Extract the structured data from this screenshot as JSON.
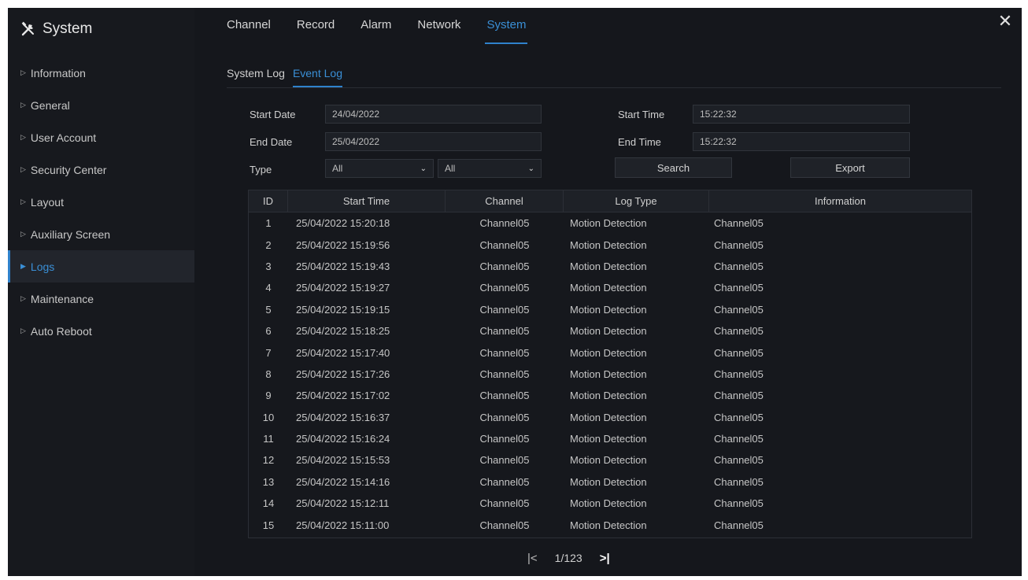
{
  "app": {
    "title": "System",
    "close_symbol": "✕"
  },
  "topnav": [
    {
      "label": "Channel",
      "active": false
    },
    {
      "label": "Record",
      "active": false
    },
    {
      "label": "Alarm",
      "active": false
    },
    {
      "label": "Network",
      "active": false
    },
    {
      "label": "System",
      "active": true
    }
  ],
  "sidebar": {
    "items": [
      {
        "label": "Information",
        "active": false
      },
      {
        "label": "General",
        "active": false
      },
      {
        "label": "User Account",
        "active": false
      },
      {
        "label": "Security Center",
        "active": false
      },
      {
        "label": "Layout",
        "active": false
      },
      {
        "label": "Auxiliary Screen",
        "active": false
      },
      {
        "label": "Logs",
        "active": true
      },
      {
        "label": "Maintenance",
        "active": false
      },
      {
        "label": "Auto Reboot",
        "active": false
      }
    ]
  },
  "subtabs": [
    {
      "label": "System Log",
      "active": false
    },
    {
      "label": "Event Log",
      "active": true
    }
  ],
  "filters": {
    "start_date_label": "Start Date",
    "start_date_value": "24/04/2022",
    "end_date_label": "End Date",
    "end_date_value": "25/04/2022",
    "type_label": "Type",
    "type_value_1": "All",
    "type_value_2": "All",
    "start_time_label": "Start Time",
    "start_time_value": "15:22:32",
    "end_time_label": "End Time",
    "end_time_value": "15:22:32",
    "search_label": "Search",
    "export_label": "Export"
  },
  "table": {
    "columns": [
      "ID",
      "Start Time",
      "Channel",
      "Log Type",
      "Information"
    ],
    "rows": [
      [
        "1",
        "25/04/2022 15:20:18",
        "Channel05",
        "Motion Detection",
        "Channel05"
      ],
      [
        "2",
        "25/04/2022 15:19:56",
        "Channel05",
        "Motion Detection",
        "Channel05"
      ],
      [
        "3",
        "25/04/2022 15:19:43",
        "Channel05",
        "Motion Detection",
        "Channel05"
      ],
      [
        "4",
        "25/04/2022 15:19:27",
        "Channel05",
        "Motion Detection",
        "Channel05"
      ],
      [
        "5",
        "25/04/2022 15:19:15",
        "Channel05",
        "Motion Detection",
        "Channel05"
      ],
      [
        "6",
        "25/04/2022 15:18:25",
        "Channel05",
        "Motion Detection",
        "Channel05"
      ],
      [
        "7",
        "25/04/2022 15:17:40",
        "Channel05",
        "Motion Detection",
        "Channel05"
      ],
      [
        "8",
        "25/04/2022 15:17:26",
        "Channel05",
        "Motion Detection",
        "Channel05"
      ],
      [
        "9",
        "25/04/2022 15:17:02",
        "Channel05",
        "Motion Detection",
        "Channel05"
      ],
      [
        "10",
        "25/04/2022 15:16:37",
        "Channel05",
        "Motion Detection",
        "Channel05"
      ],
      [
        "11",
        "25/04/2022 15:16:24",
        "Channel05",
        "Motion Detection",
        "Channel05"
      ],
      [
        "12",
        "25/04/2022 15:15:53",
        "Channel05",
        "Motion Detection",
        "Channel05"
      ],
      [
        "13",
        "25/04/2022 15:14:16",
        "Channel05",
        "Motion Detection",
        "Channel05"
      ],
      [
        "14",
        "25/04/2022 15:12:11",
        "Channel05",
        "Motion Detection",
        "Channel05"
      ],
      [
        "15",
        "25/04/2022 15:11:00",
        "Channel05",
        "Motion Detection",
        "Channel05"
      ]
    ]
  },
  "pagination": {
    "first_symbol": "|<",
    "page_text": "1/123",
    "last_symbol": ">|"
  },
  "colors": {
    "accent": "#2f82cc",
    "background": "#15171c",
    "sidebar": "#17191e"
  },
  "icons": {
    "brand": "tools-icon",
    "close": "close-icon"
  }
}
